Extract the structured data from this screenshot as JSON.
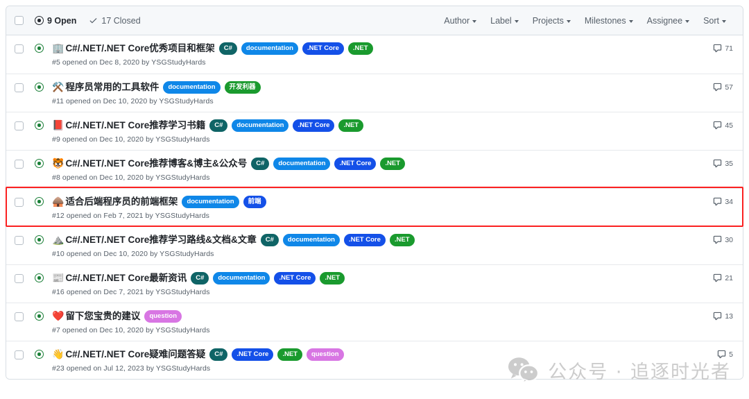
{
  "header": {
    "checkbox_name": "select-all-checkbox",
    "open": {
      "count_label": "9 Open",
      "icon": "issue-opened-icon"
    },
    "closed": {
      "count_label": "17 Closed",
      "icon": "check-icon"
    },
    "filters": [
      {
        "label": "Author"
      },
      {
        "label": "Label"
      },
      {
        "label": "Projects"
      },
      {
        "label": "Milestones"
      },
      {
        "label": "Assignee"
      },
      {
        "label": "Sort"
      }
    ]
  },
  "label_colors": {
    "csharp": "#0f6466",
    "documentation": "#0f87e8",
    "netcore": "#1450e8",
    "net": "#1a9a2e",
    "devtool": "#1a9a2e",
    "frontend": "#1450e8",
    "question": "#d876e3"
  },
  "issues": [
    {
      "emoji": "🏢",
      "emoji_name": "office-building-emoji",
      "title": "C#/.NET/.NET Core优秀项目和框架",
      "labels": [
        {
          "text": "C#",
          "color": "#0f6466"
        },
        {
          "text": "documentation",
          "color": "#0f87e8"
        },
        {
          "text": ".NET Core",
          "color": "#1450e8"
        },
        {
          "text": ".NET",
          "color": "#1a9a2e"
        }
      ],
      "meta": "#5 opened on Dec 8, 2020 by YSGStudyHards",
      "comments": "71",
      "highlighted": false
    },
    {
      "emoji": "⚒️",
      "emoji_name": "hammer-and-pick-emoji",
      "title": "程序员常用的工具软件",
      "labels": [
        {
          "text": "documentation",
          "color": "#0f87e8"
        },
        {
          "text": "开发利器",
          "color": "#1a9a2e"
        }
      ],
      "meta": "#11 opened on Dec 10, 2020 by YSGStudyHards",
      "comments": "57",
      "highlighted": false
    },
    {
      "emoji": "📕",
      "emoji_name": "closed-book-emoji",
      "title": "C#/.NET/.NET Core推荐学习书籍",
      "labels": [
        {
          "text": "C#",
          "color": "#0f6466"
        },
        {
          "text": "documentation",
          "color": "#0f87e8"
        },
        {
          "text": ".NET Core",
          "color": "#1450e8"
        },
        {
          "text": ".NET",
          "color": "#1a9a2e"
        }
      ],
      "meta": "#9 opened on Dec 10, 2020 by YSGStudyHards",
      "comments": "45",
      "highlighted": false
    },
    {
      "emoji": "🐯",
      "emoji_name": "tiger-face-emoji",
      "title": "C#/.NET/.NET Core推荐博客&博主&公众号",
      "labels": [
        {
          "text": "C#",
          "color": "#0f6466"
        },
        {
          "text": "documentation",
          "color": "#0f87e8"
        },
        {
          "text": ".NET Core",
          "color": "#1450e8"
        },
        {
          "text": ".NET",
          "color": "#1a9a2e"
        }
      ],
      "meta": "#8 opened on Dec 10, 2020 by YSGStudyHards",
      "comments": "35",
      "highlighted": false
    },
    {
      "emoji": "🛖",
      "emoji_name": "hut-emoji",
      "title": "适合后端程序员的前端框架",
      "labels": [
        {
          "text": "documentation",
          "color": "#0f87e8"
        },
        {
          "text": "前端",
          "color": "#1450e8"
        }
      ],
      "meta": "#12 opened on Feb 7, 2021 by YSGStudyHards",
      "comments": "34",
      "highlighted": true
    },
    {
      "emoji": "⛰️",
      "emoji_name": "mountain-emoji",
      "title": "C#/.NET/.NET Core推荐学习路线&文档&文章",
      "labels": [
        {
          "text": "C#",
          "color": "#0f6466"
        },
        {
          "text": "documentation",
          "color": "#0f87e8"
        },
        {
          "text": ".NET Core",
          "color": "#1450e8"
        },
        {
          "text": ".NET",
          "color": "#1a9a2e"
        }
      ],
      "meta": "#10 opened on Dec 10, 2020 by YSGStudyHards",
      "comments": "30",
      "highlighted": false
    },
    {
      "emoji": "📰",
      "emoji_name": "newspaper-emoji",
      "title": "C#/.NET/.NET Core最新资讯",
      "labels": [
        {
          "text": "C#",
          "color": "#0f6466"
        },
        {
          "text": "documentation",
          "color": "#0f87e8"
        },
        {
          "text": ".NET Core",
          "color": "#1450e8"
        },
        {
          "text": ".NET",
          "color": "#1a9a2e"
        }
      ],
      "meta": "#16 opened on Dec 7, 2021 by YSGStudyHards",
      "comments": "21",
      "highlighted": false
    },
    {
      "emoji": "❤️",
      "emoji_name": "heart-emoji",
      "title": "留下您宝贵的建议",
      "labels": [
        {
          "text": "question",
          "color": "#d876e3"
        }
      ],
      "meta": "#7 opened on Dec 10, 2020 by YSGStudyHards",
      "comments": "13",
      "highlighted": false
    },
    {
      "emoji": "👋",
      "emoji_name": "waving-hand-emoji",
      "title": "C#/.NET/.NET Core疑难问题答疑",
      "labels": [
        {
          "text": "C#",
          "color": "#0f6466"
        },
        {
          "text": ".NET Core",
          "color": "#1450e8"
        },
        {
          "text": ".NET",
          "color": "#1a9a2e"
        },
        {
          "text": "question",
          "color": "#d876e3"
        }
      ],
      "meta": "#23 opened on Jul 12, 2023 by YSGStudyHards",
      "comments": "5",
      "highlighted": false
    }
  ],
  "watermark": {
    "text": "公众号 · 追逐时光者",
    "icon": "wechat-logo"
  },
  "annotation": {
    "color": "#fb2020",
    "target_issue": "#12"
  }
}
